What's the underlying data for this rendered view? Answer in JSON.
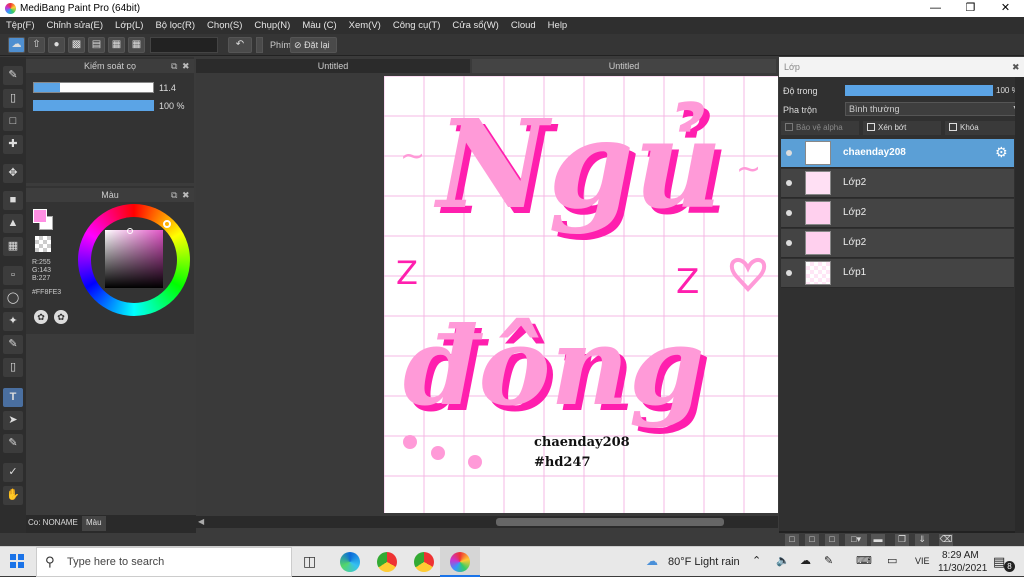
{
  "window": {
    "title": "MediBang Paint Pro (64bit)"
  },
  "menu": [
    "Tệp(F)",
    "Chỉnh sửa(E)",
    "Lớp(L)",
    "Bộ lọc(R)",
    "Chọn(S)",
    "Chụp(N)",
    "Màu (C)",
    "Xem(V)",
    "Công cụ(T)",
    "Cửa sổ(W)",
    "Cloud",
    "Help"
  ],
  "toolbar": {
    "shortcut_label": "Phím",
    "reset_label": "Đặt lại"
  },
  "brush_panel": {
    "title": "Kiểm soát cọ",
    "size_value": "11.4",
    "size_fraction": 0.22,
    "opacity_value": "100 %",
    "opacity_fraction": 1.0
  },
  "color_panel": {
    "title": "Màu",
    "r": "R:255",
    "g": "G:143",
    "b": "B:227",
    "hex": "#FF8FE3",
    "foreground": "#ff8fe3"
  },
  "bottom_tabs": {
    "brush": "Co: NONAME",
    "color": "Màu"
  },
  "documents": [
    {
      "title": "Untitled"
    },
    {
      "title": "Untitled"
    }
  ],
  "artwork": {
    "line1": "Ngủ",
    "line2": "đông",
    "signature": "chaenday208",
    "hashtag": "#hd247",
    "doodle_z1": "Z",
    "doodle_z2": "Z",
    "tilde": "~",
    "pink": "#ff9ad8",
    "magenta": "#ff1fae"
  },
  "layer_panel": {
    "title": "Lớp",
    "opacity_label": "Độ trong",
    "opacity_value": "100 %",
    "opacity_fraction": 1.0,
    "blend_label": "Pha trộn",
    "blend_value": "Bình thường",
    "protect_alpha": "Bảo vệ alpha",
    "clipping": "Xén bớt",
    "lock": "Khóa",
    "layers": [
      {
        "name": "chaenday208",
        "selected": true
      },
      {
        "name": "Lớp2",
        "selected": false
      },
      {
        "name": "Lớp2",
        "selected": false
      },
      {
        "name": "Lớp2",
        "selected": false
      },
      {
        "name": "Lớp1",
        "selected": false
      }
    ]
  },
  "taskbar": {
    "search_placeholder": "Type here to search",
    "weather": "80°F  Light rain",
    "lang": "VIE",
    "time": "8:29 AM",
    "date": "11/30/2021",
    "notifications": "8"
  }
}
